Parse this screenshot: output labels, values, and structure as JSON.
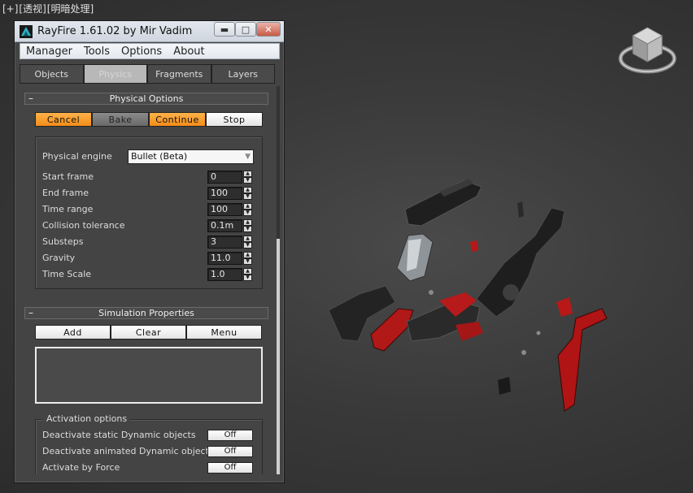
{
  "viewport": {
    "label_parts": [
      "[+]",
      "[透视]",
      "[明暗处理]"
    ]
  },
  "window": {
    "title": "RayFire 1.61.02  by Mir Vadim",
    "controls": {
      "minimize": "▬",
      "maximize": "□",
      "close": "✕"
    }
  },
  "menubar": {
    "items": [
      "Manager",
      "Tools",
      "Options",
      "About"
    ]
  },
  "tabs": [
    {
      "label": "Objects",
      "active": false
    },
    {
      "label": "Physics",
      "active": true
    },
    {
      "label": "Fragments",
      "active": false
    },
    {
      "label": "Layers",
      "active": false
    }
  ],
  "physical_options": {
    "title": "Physical Options",
    "collapse": "–",
    "buttons": [
      "Cancel",
      "Bake",
      "Continue",
      "Stop"
    ],
    "engine_label": "Physical engine",
    "engine_value": "Bullet (Beta)",
    "params": [
      {
        "label": "Start frame",
        "value": "0"
      },
      {
        "label": "End frame",
        "value": "100"
      },
      {
        "label": "Time range",
        "value": "100"
      },
      {
        "label": "Collision tolerance",
        "value": "0.1m"
      },
      {
        "label": "Substeps",
        "value": "3"
      },
      {
        "label": "Gravity",
        "value": "11.0"
      },
      {
        "label": "Time Scale",
        "value": "1.0"
      }
    ]
  },
  "simulation_properties": {
    "title": "Simulation Properties",
    "collapse": "–",
    "buttons": [
      "Add",
      "Clear",
      "Menu"
    ]
  },
  "activation_options": {
    "title": "Activation options",
    "rows": [
      {
        "label": "Deactivate static Dynamic objects",
        "value": "Off"
      },
      {
        "label": "Deactivate animated Dynamic objects",
        "value": "Off"
      },
      {
        "label": "Activate by Force",
        "value": "Off"
      }
    ]
  },
  "colors": {
    "orange_button": "#f28c18",
    "panel_bg": "#444444",
    "fragment_red": "#b01818",
    "fragment_black": "#1c1c1c"
  }
}
